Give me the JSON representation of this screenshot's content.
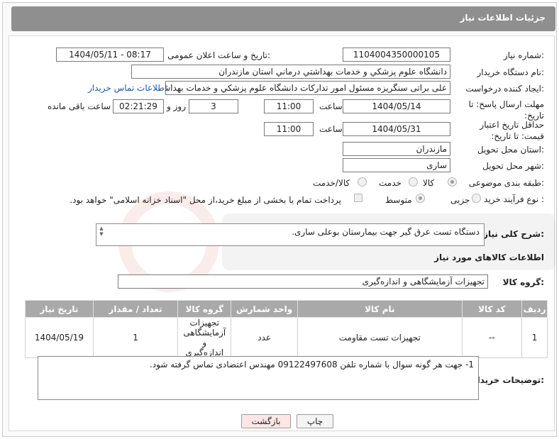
{
  "header": {
    "title": "جزئیات اطلاعات نیاز"
  },
  "fields": {
    "need_number": {
      "label": "شماره نیاز:",
      "value": "1104004350000105"
    },
    "announce_datetime": {
      "label": "تاریخ و ساعت اعلان عمومی:",
      "value": "1404/05/11 - 08:17"
    },
    "buyer_org": {
      "label": "نام دستگاه خریدار:",
      "value": "دانشگاه علوم پزشکي و خدمات بهداشتي  درماني استان مازندران"
    },
    "requester": {
      "label": "ایجاد کننده درخواست:",
      "value": "علی براتی سنگریزه مسئول امور تداركات دانشگاه علوم پزشکي و خدمات بهداشتي",
      "contact_link": "اطلاعات تماس خریدار"
    },
    "reply_deadline": {
      "label": "مهلت ارسال پاسخ: تا تاریخ:",
      "date": "1404/05/14",
      "time_label": "ساعت",
      "time": "11:00",
      "days": "3",
      "days_label": "روز و",
      "remaining": "02:21:29",
      "remaining_label": "ساعت باقی مانده"
    },
    "price_validity": {
      "label": "حداقل تاریخ اعتبار قیمت: تا تاریخ:",
      "date": "1404/05/31",
      "time_label": "ساعت",
      "time": "11:00"
    },
    "province": {
      "label": "استان محل تحویل:",
      "value": "مازندران"
    },
    "city": {
      "label": "شهر محل تحویل:",
      "value": "ساری"
    },
    "category": {
      "label": "طبقه بندی موضوعی:",
      "options": [
        "کالا",
        "خدمت",
        "کالا/خدمت"
      ],
      "selected": "کالا"
    },
    "purchase_type": {
      "label": "نوع فرآیند خرید :",
      "options": [
        "جزیی",
        "متوسط"
      ],
      "selected": "متوسط",
      "payment_note": "پرداخت تمام یا بخشی از مبلغ خرید،از محل \"اسناد خزانه اسلامی\" خواهد بود."
    },
    "description": {
      "label": "شرح کلی نیاز:",
      "value": "دستگاه تست عرق گیر جهت بیمارستان بوعلی ساری."
    }
  },
  "goods_section": {
    "title": "اطلاعات کالاهای مورد نیاز",
    "group_label": "گروه کالا:",
    "group_value": "تجهیزات آزمایشگاهی و اندازه‌گیری"
  },
  "table": {
    "headers": [
      "ردیف",
      "کد کالا",
      "نام کالا",
      "واحد شمارش",
      "گروه کالا",
      "تعداد / مقدار",
      "تاریخ نیاز"
    ],
    "rows": [
      [
        "1",
        "--",
        "تجهیزات تست مقاومت",
        "عدد",
        "تجهیزات آزمایشگاهی و اندازه‌گیری",
        "1",
        "1404/05/19"
      ]
    ]
  },
  "buyer_notes": {
    "label": "توضیحات خریدار:",
    "value": "1- جهت هر گونه سوال با شماره تلفن 09122497608 مهندس اعتضادی تماس گرفته شود."
  },
  "buttons": {
    "print": "چاپ",
    "back": "بازگشت"
  },
  "colors": {
    "header_bg": "#8f8f8f",
    "table_header_bg": "#a9a9a9",
    "link": "#1a5aa8",
    "back_button_bg": "#fde6e6"
  }
}
